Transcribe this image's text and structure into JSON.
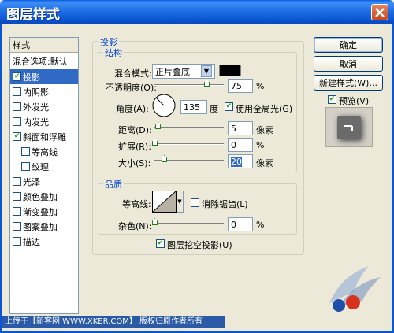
{
  "window": {
    "title": "图层样式"
  },
  "sidebar": {
    "header": "样式",
    "items": [
      {
        "label": "混合选项:默认",
        "checkbox": false
      },
      {
        "label": "投影",
        "checked": true,
        "selected": true
      },
      {
        "label": "内阴影",
        "checked": false
      },
      {
        "label": "外发光",
        "checked": false
      },
      {
        "label": "内发光",
        "checked": false
      },
      {
        "label": "斜面和浮雕",
        "checked": true
      },
      {
        "label": "等高线",
        "checked": false,
        "indent": true
      },
      {
        "label": "纹理",
        "checked": false,
        "indent": true
      },
      {
        "label": "光泽",
        "checked": false
      },
      {
        "label": "颜色叠加",
        "checked": false
      },
      {
        "label": "渐变叠加",
        "checked": false
      },
      {
        "label": "图案叠加",
        "checked": false
      },
      {
        "label": "描边",
        "checked": false
      }
    ]
  },
  "shadow": {
    "group_title": "投影",
    "structure_title": "结构",
    "blend_mode_label": "混合模式:",
    "blend_mode_value": "正片叠底",
    "opacity_label": "不透明度(O):",
    "opacity_value": "75",
    "opacity_unit": "%",
    "opacity_level": 0.75,
    "angle_label": "角度(A):",
    "angle_value": "135",
    "angle_unit": "度",
    "global_light_label": "使用全局光(G)",
    "distance_label": "距离(D):",
    "distance_value": "5",
    "distance_unit": "像素",
    "spread_label": "扩展(R):",
    "spread_value": "0",
    "spread_unit": "%",
    "size_label": "大小(S):",
    "size_value": "20",
    "size_unit": "像素",
    "quality_title": "品质",
    "contour_label": "等高线:",
    "antialias_label": "消除锯齿(L)",
    "noise_label": "杂色(N):",
    "noise_value": "0",
    "noise_unit": "%",
    "knockout_label": "图层挖空投影(U)"
  },
  "buttons": {
    "ok": "确定",
    "cancel": "取消",
    "new_style": "新建样式(W)...",
    "preview": "预览(V)"
  },
  "footer": {
    "text": "上传于【新客网 WWW.XKER.COM】 版权归原作者所有"
  },
  "colors": {
    "title_bar": "#0b56d4",
    "selected": "#316ac5",
    "group_label": "#0046d5"
  }
}
